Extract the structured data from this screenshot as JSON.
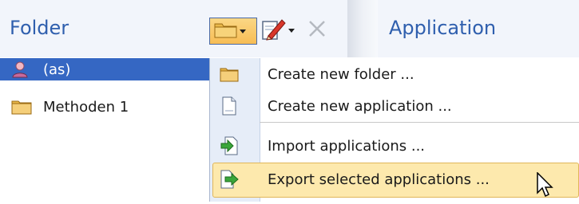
{
  "header": {
    "folder_title": "Folder",
    "application_title": "Application"
  },
  "toolbar": {
    "buttons": [
      {
        "name": "folder-menu-button",
        "icon": "folder-icon",
        "has_dropdown": true
      },
      {
        "name": "edit-menu-button",
        "icon": "edit-icon",
        "has_dropdown": true
      },
      {
        "name": "delete-button",
        "icon": "close-icon",
        "enabled": false
      }
    ]
  },
  "tree": {
    "items": [
      {
        "label": "(as)",
        "icon": "user-icon",
        "selected": true
      },
      {
        "label": "Methoden 1",
        "icon": "folder-icon",
        "selected": false
      }
    ]
  },
  "menu": {
    "items": [
      {
        "label": "Create new folder ...",
        "icon": "folder-icon"
      },
      {
        "label": "Create new application ...",
        "icon": "document-icon"
      },
      {
        "label": "Import applications ...",
        "icon": "import-icon"
      },
      {
        "label": "Export selected applications ...",
        "icon": "export-icon",
        "highlighted": true
      }
    ]
  },
  "colors": {
    "accent": "#2f5fae",
    "selection": "#3567c3",
    "menu_highlight": "#fde9ad",
    "menu_gutter": "#e6edf8"
  }
}
